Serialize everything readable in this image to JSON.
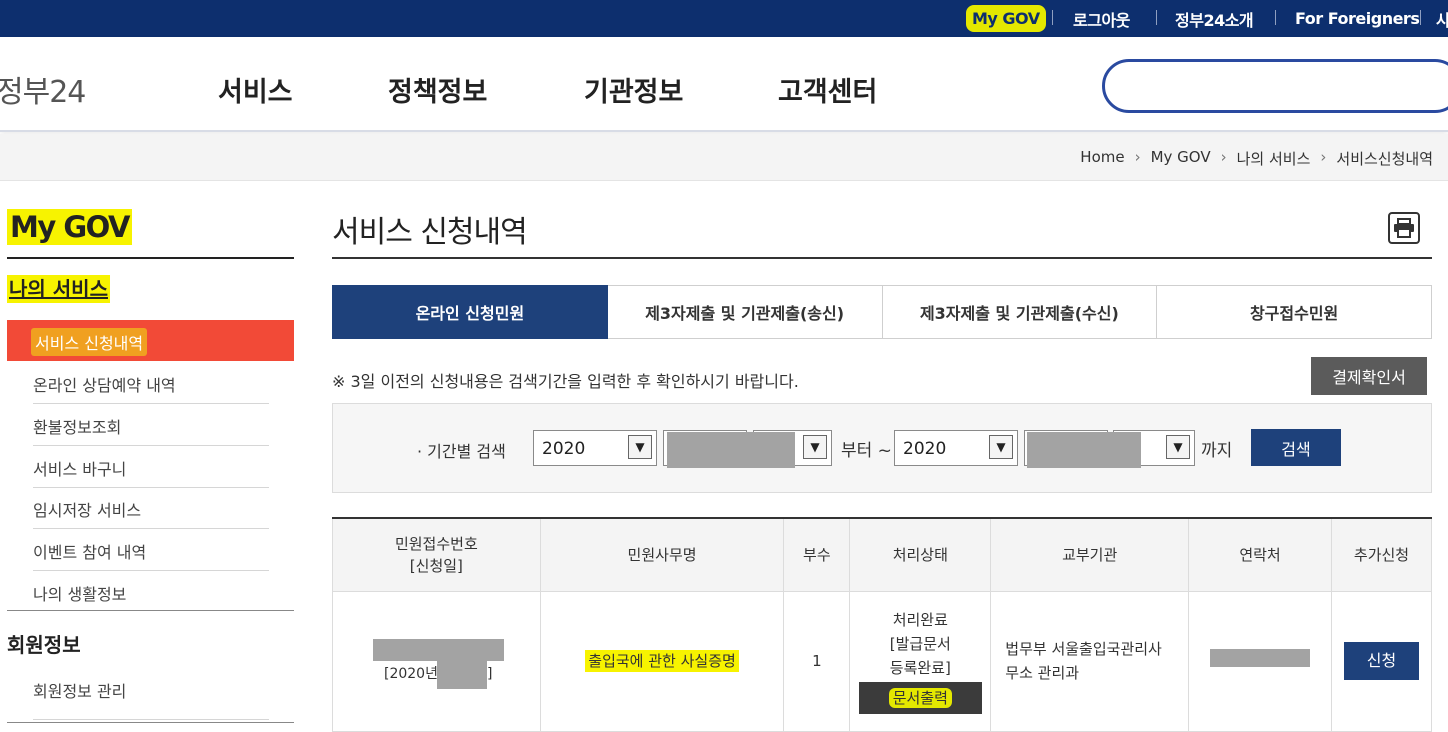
{
  "topbar": {
    "my_gov": "My GOV",
    "logout": "로그아웃",
    "about": "정부24소개",
    "foreigners": "For Foreigners",
    "cut": "사"
  },
  "header": {
    "logo": "정부24",
    "nav": [
      "서비스",
      "정책정보",
      "기관정보",
      "고객센터"
    ]
  },
  "breadcrumb": [
    "Home",
    "My GOV",
    "나의 서비스",
    "서비스신청내역"
  ],
  "sidebar": {
    "title": "My GOV",
    "section1": "나의 서비스",
    "active_item": "서비스 신청내역",
    "items": [
      "온라인 상담예약 내역",
      "환불정보조회",
      "서비스 바구니",
      "임시저장 서비스",
      "이벤트 참여 내역",
      "나의 생활정보"
    ],
    "section2": "회원정보",
    "section2_items": [
      "회원정보 관리"
    ]
  },
  "main": {
    "title": "서비스 신청내역",
    "tabs": [
      "온라인 신청민원",
      "제3자제출 및 기관제출(송신)",
      "제3자제출 및 기관제출(수신)",
      "창구접수민원"
    ],
    "notice": "※ 3일 이전의 신청내용은 검색기간을 입력한 후 확인하시기 바랍니다.",
    "pay_button": "결제확인서",
    "search": {
      "label": "· 기간별 검색",
      "from_year": "2020",
      "from_text": "부터 ~",
      "to_year": "2020",
      "to_text": "까지",
      "button": "검색"
    },
    "table": {
      "headers": [
        "민원접수번호\n[신청일]",
        "민원사무명",
        "부수",
        "처리상태",
        "교부기관",
        "연락처",
        "추가신청"
      ],
      "row": {
        "date_prefix": "[2020년",
        "date_suffix": "]",
        "name": "출입국에 관한 사실증명",
        "count": "1",
        "status": "처리완료\n[발급문서\n등록완료]",
        "doc_button": "문서출력",
        "agency": "법무부 서울출입국관리사무소 관리과",
        "apply_button": "신청"
      }
    }
  }
}
